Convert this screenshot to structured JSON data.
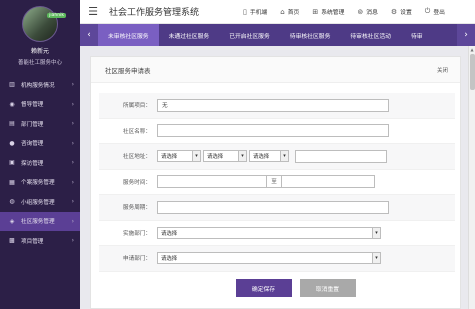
{
  "sidebar": {
    "user_badge": "jiahnik",
    "user_name": "赖新元",
    "user_org": "善能社工服务中心",
    "items": [
      {
        "label": "机构服务情况",
        "icon": "chart-icon"
      },
      {
        "label": "督导管理",
        "icon": "eye-icon"
      },
      {
        "label": "部门管理",
        "icon": "org-icon"
      },
      {
        "label": "咨询管理",
        "icon": "chat-icon"
      },
      {
        "label": "探访管理",
        "icon": "visit-icon"
      },
      {
        "label": "个案服务管理",
        "icon": "grid-icon"
      },
      {
        "label": "小组服务管理",
        "icon": "group-icon"
      },
      {
        "label": "社区服务管理",
        "icon": "community-icon"
      },
      {
        "label": "项目管理",
        "icon": "project-icon"
      }
    ]
  },
  "topbar": {
    "title": "社会工作服务管理系统",
    "nav": [
      {
        "label": "手机端",
        "icon": "phone-icon"
      },
      {
        "label": "首页",
        "icon": "home-icon"
      },
      {
        "label": "系统管理",
        "icon": "settings-grid-icon"
      },
      {
        "label": "消息",
        "icon": "bell-icon"
      },
      {
        "label": "设置",
        "icon": "gear-icon"
      },
      {
        "label": "登出",
        "icon": "logout-icon"
      }
    ]
  },
  "tabs": [
    "未审核社区服务",
    "未通过社区服务",
    "已开启社区服务",
    "待审核社区服务",
    "待审核社区活动",
    "待审"
  ],
  "panel": {
    "title": "社区服务申请表",
    "close_label": "关闭"
  },
  "form": {
    "project_label": "所属项目：",
    "project_value": "无",
    "name_label": "社区名称：",
    "address_label": "社区地址：",
    "select_placeholder": "请选择",
    "time_label": "服务时间：",
    "time_sep": "至",
    "cycle_label": "服务周期：",
    "dept_label": "实施部门：",
    "apply_dept_label": "申请部门："
  },
  "buttons": {
    "save": "确定保存",
    "reset": "取消重置"
  },
  "colors": {
    "sidebar_bg": "#2c1f47",
    "accent": "#5b3f95",
    "tab_active": "#7a5fc2"
  }
}
